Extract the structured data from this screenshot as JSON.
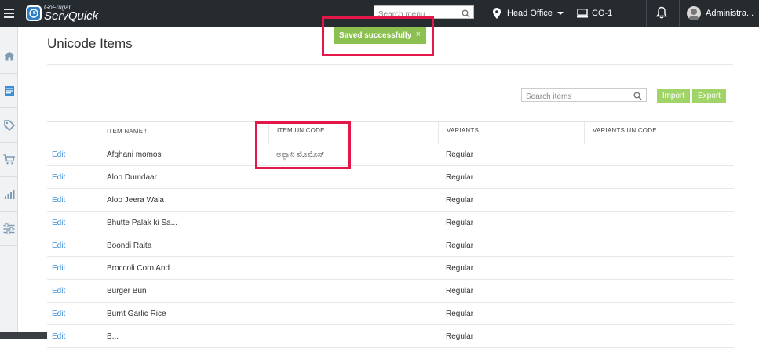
{
  "app": {
    "brand_small": "GoFrugal",
    "brand_big": "ServQuick"
  },
  "topbar": {
    "search_placeholder": "Search menu",
    "location": "Head Office",
    "counter": "CO-1",
    "user": "Administra..."
  },
  "toast": {
    "message": "Saved successfully",
    "close": "×"
  },
  "page": {
    "title": "Unicode Items",
    "search_placeholder": "Search items",
    "import_label": "Import",
    "export_label": "Export"
  },
  "table": {
    "headers": {
      "item_name": "ITEM NAME",
      "sort_indicator": "↑",
      "item_unicode": "ITEM UNICODE",
      "variants": "VARIANTS",
      "variants_unicode": "VARIANTS UNICODE"
    },
    "edit_label": "Edit",
    "rows": [
      {
        "name": "Afghani momos",
        "unicode": "ಅಫ್ಘಾನಿ ಮೊಮೊಸ್",
        "variant": "Regular",
        "variant_unicode": ""
      },
      {
        "name": "Aloo Dumdaar",
        "unicode": "",
        "variant": "Regular",
        "variant_unicode": ""
      },
      {
        "name": "Aloo Jeera Wala",
        "unicode": "",
        "variant": "Regular",
        "variant_unicode": ""
      },
      {
        "name": "Bhutte Palak ki Sa...",
        "unicode": "",
        "variant": "Regular",
        "variant_unicode": ""
      },
      {
        "name": "Boondi Raita",
        "unicode": "",
        "variant": "Regular",
        "variant_unicode": ""
      },
      {
        "name": "Broccoli Corn And ...",
        "unicode": "",
        "variant": "Regular",
        "variant_unicode": ""
      },
      {
        "name": "Burger Bun",
        "unicode": "",
        "variant": "Regular",
        "variant_unicode": ""
      },
      {
        "name": "Burnt Garlic Rice",
        "unicode": "",
        "variant": "Regular",
        "variant_unicode": ""
      },
      {
        "name": "B...",
        "unicode": "",
        "variant": "Regular",
        "variant_unicode": ""
      }
    ]
  },
  "colors": {
    "topbar": "#262b30",
    "toast": "#8cc152",
    "button": "#a0d468",
    "link": "#3b8ed6",
    "highlight": "#e3174a"
  }
}
